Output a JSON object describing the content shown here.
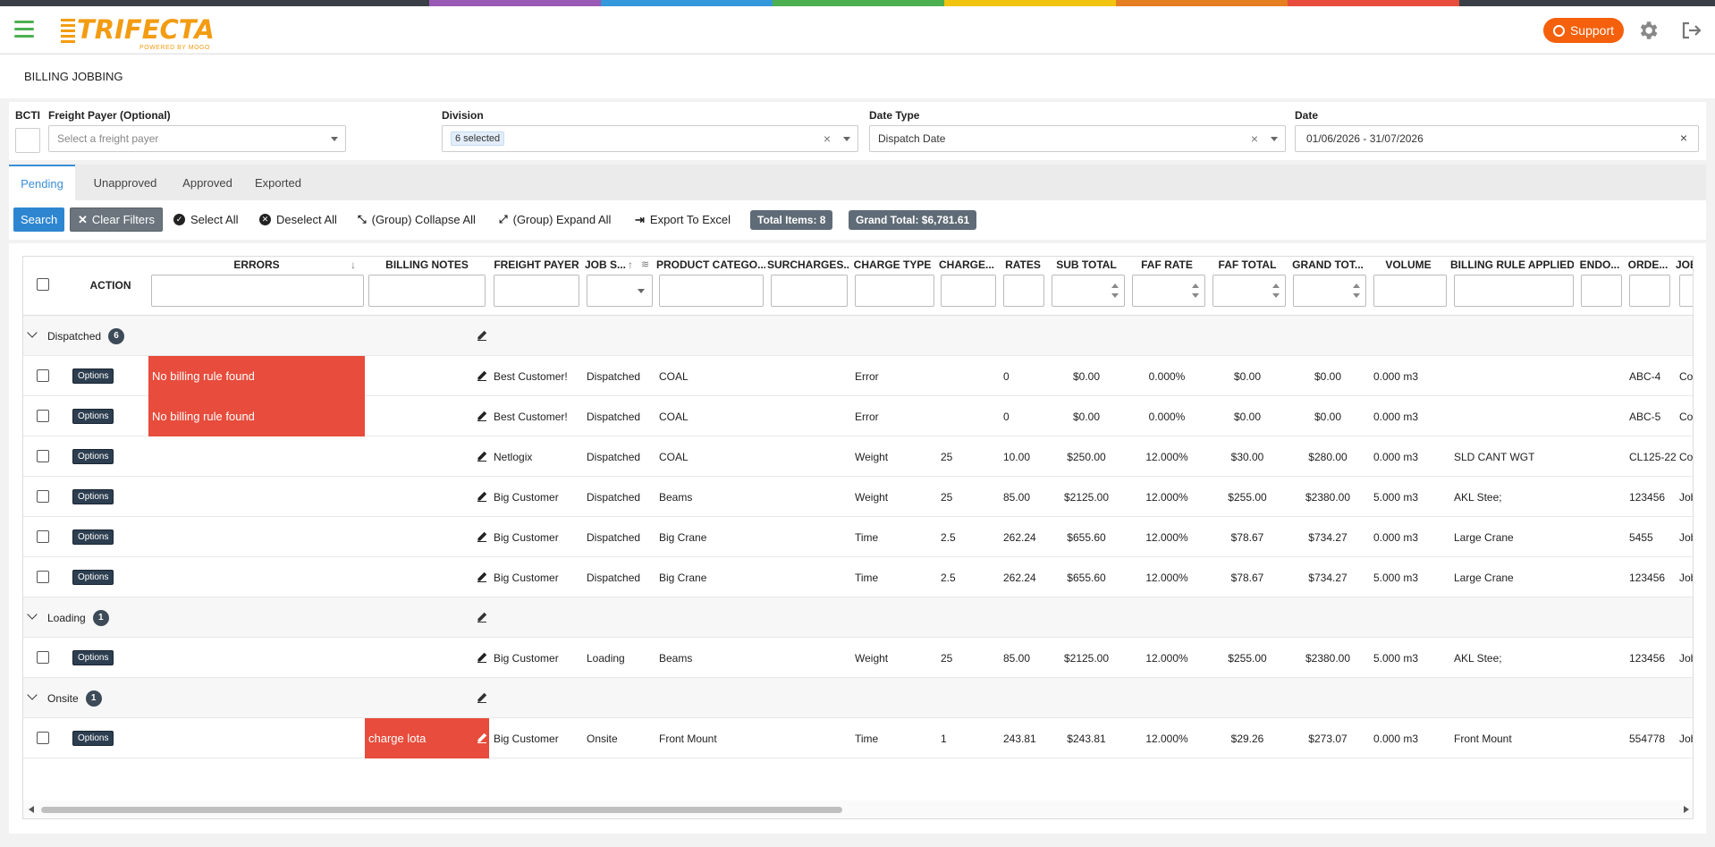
{
  "app": {
    "logo_text": "TRIFECTA",
    "logo_sub": "POWERED BY MOGO",
    "support_label": "Support",
    "stripe_colors": [
      "#3a3f47",
      "#9b59b6",
      "#3498db",
      "#4caf50",
      "#f1c40f",
      "#e67e22",
      "#e74c3c",
      "#3a3f47"
    ]
  },
  "page": {
    "title": "BILLING JOBBING"
  },
  "filters": {
    "bcti_label": "BCTI",
    "freight_payer_label": "Freight Payer (Optional)",
    "freight_payer_placeholder": "Select a freight payer",
    "division_label": "Division",
    "division_value": "6 selected",
    "date_type_label": "Date Type",
    "date_type_value": "Dispatch Date",
    "date_label": "Date",
    "date_value": "01/06/2026 - 31/07/2026"
  },
  "tabs": [
    {
      "label": "Pending",
      "active": true
    },
    {
      "label": "Unapproved",
      "active": false
    },
    {
      "label": "Approved",
      "active": false
    },
    {
      "label": "Exported",
      "active": false
    }
  ],
  "toolbar": {
    "search": "Search",
    "clear_filters": "Clear Filters",
    "select_all": "Select All",
    "deselect_all": "Deselect All",
    "collapse_all": "(Group) Collapse All",
    "expand_all": "(Group) Expand All",
    "export": "Export To Excel",
    "total_items": "Total Items: 8",
    "grand_total": "Grand Total: $6,781.61"
  },
  "columns": {
    "action": "ACTION",
    "errors": "ERRORS",
    "billing_notes": "BILLING NOTES",
    "freight_payer": "FREIGHT PAYER",
    "job_status": "JOB S...",
    "product_category": "PRODUCT CATEGO...",
    "surcharges": "SURCHARGES...",
    "charge_type": "CHARGE TYPE",
    "charge_qty": "CHARGE...",
    "rates": "RATES",
    "sub_total": "SUB TOTAL",
    "faf_rate": "FAF RATE",
    "faf_total": "FAF TOTAL",
    "grand_total": "GRAND TOT...",
    "volume": "VOLUME",
    "billing_rule": "BILLING RULE APPLIED",
    "endo": "ENDO...",
    "order": "ORDE...",
    "job": "JOB"
  },
  "options_label": "Options",
  "groups": [
    {
      "label": "Dispatched",
      "count": "6",
      "rows": [
        {
          "error": "No billing rule found",
          "note": "",
          "payer": "Best Customer!",
          "status": "Dispatched",
          "product": "COAL",
          "charge_type": "Error",
          "qty": "",
          "rate": "0",
          "sub": "$0.00",
          "faf_rate": "0.000%",
          "faf_total": "$0.00",
          "grand": "$0.00",
          "volume": "0.000 m3",
          "rule": "",
          "order": "ABC-4",
          "job": "Con"
        },
        {
          "error": "No billing rule found",
          "note": "",
          "payer": "Best Customer!",
          "status": "Dispatched",
          "product": "COAL",
          "charge_type": "Error",
          "qty": "",
          "rate": "0",
          "sub": "$0.00",
          "faf_rate": "0.000%",
          "faf_total": "$0.00",
          "grand": "$0.00",
          "volume": "0.000 m3",
          "rule": "",
          "order": "ABC-5",
          "job": "Con"
        },
        {
          "error": "",
          "note": "",
          "payer": "Netlogix",
          "status": "Dispatched",
          "product": "COAL",
          "charge_type": "Weight",
          "qty": "25",
          "rate": "10.00",
          "sub": "$250.00",
          "faf_rate": "12.000%",
          "faf_total": "$30.00",
          "grand": "$280.00",
          "volume": "0.000 m3",
          "rule": "SLD CANT WGT",
          "order": "CL125-22",
          "job": "Con"
        },
        {
          "error": "",
          "note": "",
          "payer": "Big Customer",
          "status": "Dispatched",
          "product": "Beams",
          "charge_type": "Weight",
          "qty": "25",
          "rate": "85.00",
          "sub": "$2125.00",
          "faf_rate": "12.000%",
          "faf_total": "$255.00",
          "grand": "$2380.00",
          "volume": "5.000 m3",
          "rule": "AKL Stee;",
          "order": "123456",
          "job": "Job"
        },
        {
          "error": "",
          "note": "",
          "payer": "Big Customer",
          "status": "Dispatched",
          "product": "Big Crane",
          "charge_type": "Time",
          "qty": "2.5",
          "rate": "262.24",
          "sub": "$655.60",
          "faf_rate": "12.000%",
          "faf_total": "$78.67",
          "grand": "$734.27",
          "volume": "0.000 m3",
          "rule": "Large Crane",
          "order": "5455",
          "job": "Job"
        },
        {
          "error": "",
          "note": "",
          "payer": "Big Customer",
          "status": "Dispatched",
          "product": "Big Crane",
          "charge_type": "Time",
          "qty": "2.5",
          "rate": "262.24",
          "sub": "$655.60",
          "faf_rate": "12.000%",
          "faf_total": "$78.67",
          "grand": "$734.27",
          "volume": "5.000 m3",
          "rule": "Large Crane",
          "order": "123456",
          "job": "Job"
        }
      ]
    },
    {
      "label": "Loading",
      "count": "1",
      "rows": [
        {
          "error": "",
          "note": "",
          "payer": "Big Customer",
          "status": "Loading",
          "product": "Beams",
          "charge_type": "Weight",
          "qty": "25",
          "rate": "85.00",
          "sub": "$2125.00",
          "faf_rate": "12.000%",
          "faf_total": "$255.00",
          "grand": "$2380.00",
          "volume": "5.000 m3",
          "rule": "AKL Stee;",
          "order": "123456",
          "job": "Job"
        }
      ]
    },
    {
      "label": "Onsite",
      "count": "1",
      "rows": [
        {
          "error": "",
          "note": "charge lota",
          "payer": "Big Customer",
          "status": "Onsite",
          "product": "Front Mount",
          "charge_type": "Time",
          "qty": "1",
          "rate": "243.81",
          "sub": "$243.81",
          "faf_rate": "12.000%",
          "faf_total": "$29.26",
          "grand": "$273.07",
          "volume": "0.000 m3",
          "rule": "Front Mount",
          "order": "554778",
          "job": "Job"
        }
      ]
    }
  ]
}
